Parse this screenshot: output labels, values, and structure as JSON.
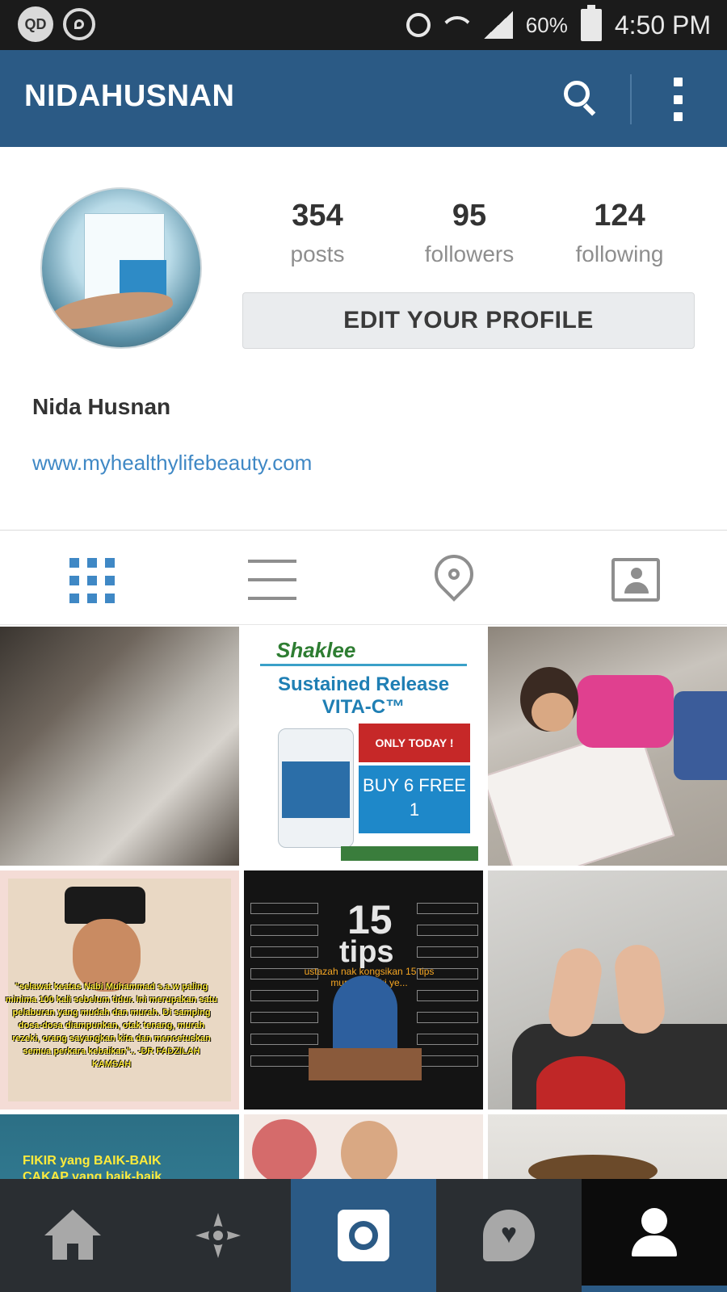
{
  "status_bar": {
    "left_badge": "QD",
    "battery_pct": "60%",
    "time": "4:50 PM",
    "icons": [
      "qd-badge-icon",
      "whatsapp-icon",
      "alarm-icon",
      "wifi-icon",
      "signal-icon",
      "battery-icon"
    ]
  },
  "header": {
    "title": "NIDAHUSNAN",
    "icons": [
      "search-icon",
      "more-options-icon"
    ]
  },
  "profile": {
    "stats": [
      {
        "value": "354",
        "label": "posts"
      },
      {
        "value": "95",
        "label": "followers"
      },
      {
        "value": "124",
        "label": "following"
      }
    ],
    "edit_button": "EDIT YOUR PROFILE",
    "full_name": "Nida Husnan",
    "website": "www.myhealthylifebeauty.com"
  },
  "tabs": [
    {
      "name": "grid",
      "icon": "grid-icon",
      "active": true
    },
    {
      "name": "list",
      "icon": "list-icon",
      "active": false
    },
    {
      "name": "places",
      "icon": "location-pin-icon",
      "active": false
    },
    {
      "name": "tagged",
      "icon": "tagged-photos-icon",
      "active": false
    }
  ],
  "photos": {
    "shaklee": {
      "brand": "Shaklee",
      "title_line1": "Sustained Release",
      "title_line2": "VITA-C™",
      "offer": "ONLY TODAY !",
      "deal": "BUY 6 FREE 1"
    },
    "quote": {
      "text": "\"selawat keatas Nabi Muhammad s.a.w paling minima 100 kali sebelum tidur. Ini merupakan satu pelaburan yang mudah dan murah. Di samping dosa-dosa diampunkan, otak tenang, murah rezeki, orang sayangkan kita dan mencetuskan semua perkara kebaikan\".. -DR FADZILAH KAMSAH"
    },
    "tips": {
      "number": "15",
      "word": "tips",
      "subtitle": "ustazah nak kongsikan 15 tips murah rezeki ye..."
    },
    "fikir": {
      "line1": "FIKIR yang BAIK-BAIK",
      "line2": "CAKAP yang baik-baik"
    }
  },
  "bottom_nav": [
    {
      "name": "home",
      "icon": "home-icon",
      "active": false
    },
    {
      "name": "explore",
      "icon": "explore-icon",
      "active": false
    },
    {
      "name": "camera",
      "icon": "camera-icon",
      "active": false
    },
    {
      "name": "activity",
      "icon": "activity-icon",
      "active": false
    },
    {
      "name": "profile",
      "icon": "profile-icon",
      "active": true
    }
  ],
  "colors": {
    "header_bg": "#2b5a85",
    "accent_blue": "#3f88c5",
    "nav_bg": "#2a2e32"
  }
}
